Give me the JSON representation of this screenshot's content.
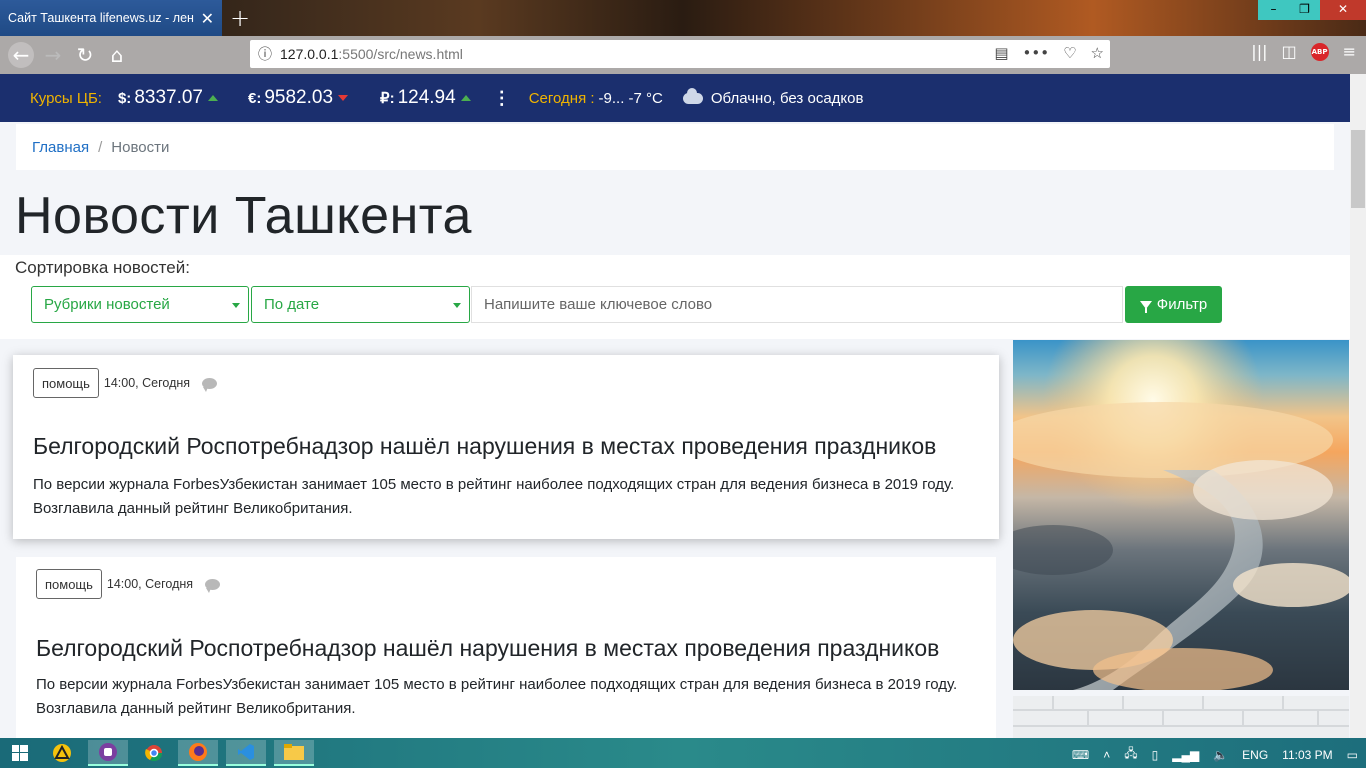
{
  "browser": {
    "tab_title": "Сайт Ташкента lifenews.uz - лента",
    "tab_close": "✕",
    "new_tab": "+",
    "url_host": "127.0.0.1",
    "url_path": ":5500/src/news.html",
    "winbtn_min": "–",
    "winbtn_max": "❐",
    "winbtn_close": "✕"
  },
  "infobar": {
    "rates_label": "Курсы ЦБ:",
    "rates": [
      {
        "currency": "$:",
        "value": "8337.07",
        "trend": "up"
      },
      {
        "currency": "€:",
        "value": "9582.03",
        "trend": "down"
      },
      {
        "currency": "₽:",
        "value": "124.94",
        "trend": "up"
      }
    ],
    "today_label": "Сегодня :",
    "temperature": "-9... -7 °C",
    "weather": "Облачно, без осадков"
  },
  "breadcrumb": {
    "home": "Главная",
    "separator": "/",
    "current": "Новости"
  },
  "page_title": "Новости Ташкента",
  "filter": {
    "sort_label": "Сортировка новостей:",
    "category_select": "Рубрики новостей",
    "date_select": "По дате",
    "keyword_placeholder": "Напишите ваше ключевое слово",
    "filter_button": "Фильтр"
  },
  "news": [
    {
      "tag": "помощь",
      "time": "14:00, Сегодня",
      "title": "Белгородский Роспотребнадзор нашёл нарушения в местах проведения праздников",
      "text": "По версии журнала ForbesУзбекистан занимает 105 место в рейтинг наиболее подходящих стран для ведения бизнеса в 2019 году. Возглавила данный рейтинг Великобритания."
    },
    {
      "tag": "помощь",
      "time": "14:00, Сегодня",
      "title": "Белгородский Роспотребнадзор нашёл нарушения в местах проведения праздников",
      "text": "По версии журнала ForbesУзбекистан занимает 105 место в рейтинг наиболее подходящих стран для ведения бизнеса в 2019 году. Возглавила данный рейтинг Великобритания."
    }
  ],
  "taskbar": {
    "language": "ENG",
    "clock": "11:03 PM"
  },
  "colors": {
    "infobar_bg": "#1b2f6e",
    "accent_green": "#28a745",
    "link_blue": "#1f6fc5",
    "rate_label_yellow": "#f0b400"
  }
}
